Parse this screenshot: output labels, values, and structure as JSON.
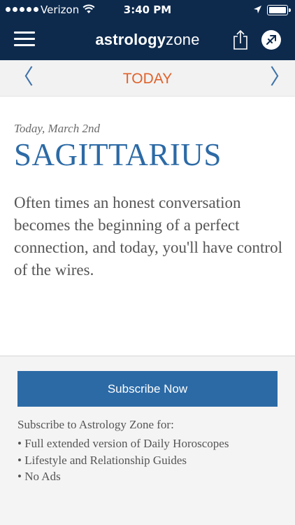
{
  "status_bar": {
    "carrier": "Verizon",
    "time": "3:40 PM"
  },
  "header": {
    "logo_bold": "astrology",
    "logo_light": "zone",
    "menu_icon": "hamburger-menu-icon",
    "share_icon": "share-icon",
    "sign_icon": "sagittarius-sign-icon"
  },
  "day_nav": {
    "prev_symbol": "〈",
    "label": "TODAY",
    "next_symbol": "〉"
  },
  "horoscope": {
    "date": "Today, March 2nd",
    "sign": "SAGITTARIUS",
    "text": "Often times an honest conversation becomes the beginning of a perfect connection, and today, you'll have control of the wires."
  },
  "subscribe": {
    "button_label": "Subscribe Now",
    "intro": "Subscribe to Astrology Zone for:",
    "benefits": [
      "• Full extended version of Daily Horoscopes",
      "• Lifestyle and Relationship Guides",
      "• No Ads"
    ]
  },
  "colors": {
    "header_bg": "#0d2a4d",
    "accent_blue": "#2c6aa6",
    "today_orange": "#e0622b",
    "body_text": "#555555"
  }
}
